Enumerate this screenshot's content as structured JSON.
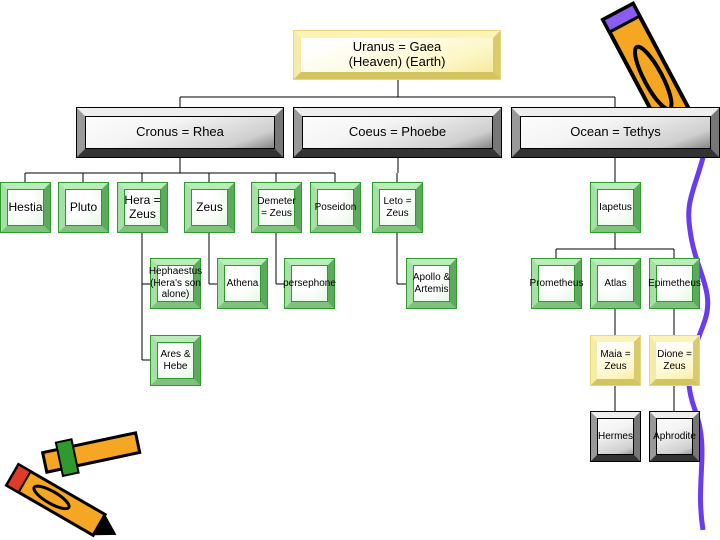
{
  "nodes": {
    "uranus": "Uranus = Gaea\n(Heaven)  (Earth)",
    "cronus": "Cronus = Rhea",
    "coeus": "Coeus = Phoebe",
    "ocean": "Ocean = Tethys",
    "hestia": "Hestia",
    "pluto": "Pluto",
    "hera": "Hera = Zeus",
    "zeus": "Zeus",
    "demeter": "Demeter = Zeus",
    "poseidon": "Poseidon",
    "leto": "Leto = Zeus",
    "iapetus": "Iapetus",
    "hephaestus": "Hephaestus (Hera's son alone)",
    "athena": "Athena",
    "persephone": "persephone",
    "apollo": "Apollo & Artemis",
    "prometheus": "Prometheus",
    "atlas": "Atlas",
    "epimetheus": "Epimetheus",
    "ares": "Ares & Hebe",
    "maia": "Maia = Zeus",
    "dione": "Dione = Zeus",
    "hermes": "Hermes",
    "aphrodite": "Aphrodite"
  },
  "colors": {
    "green": "#2e9a2e",
    "yellow": "#f3e68c",
    "grey": "#555555",
    "pencil": "#f5a623",
    "squiggle": "#6a3cf0"
  }
}
